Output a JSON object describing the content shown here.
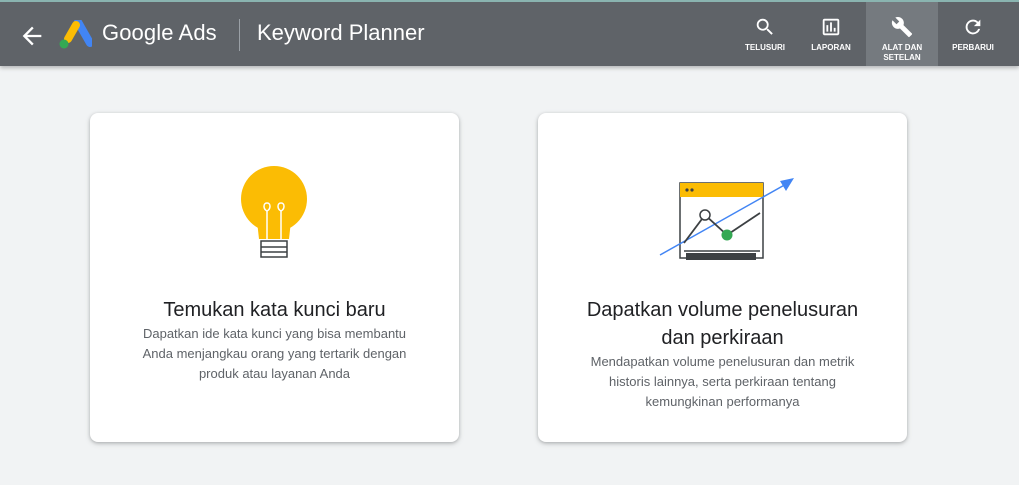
{
  "header": {
    "brand": "Google Ads",
    "product": "Keyword Planner",
    "icons": {
      "back": "arrow-left-icon",
      "logo": "google-ads-logo"
    }
  },
  "toolbar": [
    {
      "label": "TELUSURI",
      "icon": "search-icon"
    },
    {
      "label": "LAPORAN",
      "icon": "bar-chart-icon"
    },
    {
      "label_lines": [
        "ALAT DAN",
        "SETELAN"
      ],
      "icon": "wrench-icon",
      "active": true
    },
    {
      "label": "PERBARUI",
      "icon": "refresh-icon"
    }
  ],
  "cards": [
    {
      "title": "Temukan kata kunci baru",
      "description_lines": [
        "Dapatkan ide kata kunci yang bisa membantu",
        "Anda menjangkau orang yang tertarik dengan",
        "produk atau layanan Anda"
      ],
      "icon": "lightbulb-icon"
    },
    {
      "title_lines": [
        "Dapatkan volume penelusuran",
        "dan perkiraan"
      ],
      "description_lines": [
        "Mendapatkan volume penelusuran dan metrik",
        "historis lainnya, serta perkiraan tentang",
        "kemungkinan performanya"
      ],
      "icon": "trend-chart-icon"
    }
  ],
  "colors": {
    "topbar": "#5f6368",
    "background": "#f1f3f4",
    "yellow": "#fbbc04",
    "blue": "#4285f4",
    "green": "#34a853"
  }
}
